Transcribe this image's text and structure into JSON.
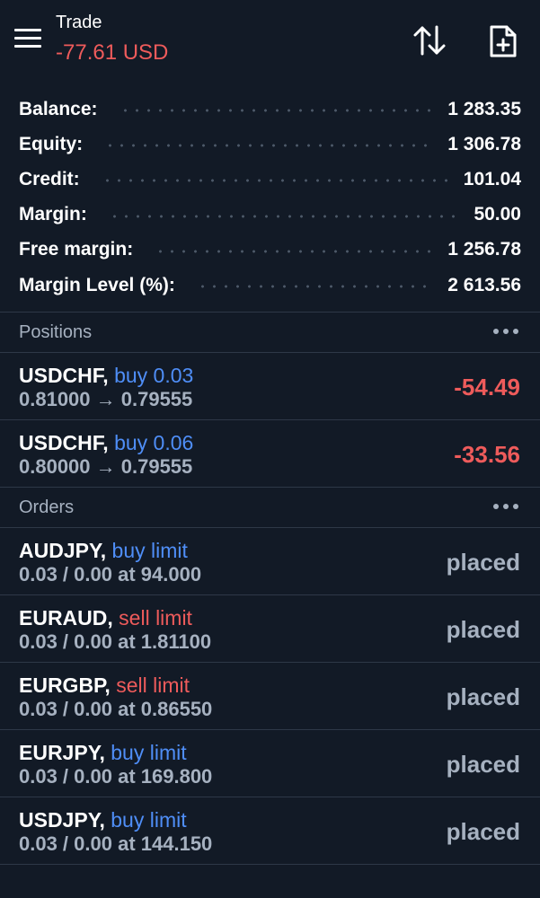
{
  "colors": {
    "background": "#121a26",
    "negative": "#ee5b5b",
    "buy": "#4f8ef7",
    "sell": "#ee5b5b",
    "muted": "#a6b1c0",
    "divider": "#2e3847"
  },
  "header": {
    "title": "Trade",
    "total": "-77.61 USD",
    "icons": [
      "menu-icon",
      "sort-icon",
      "new-order-icon"
    ]
  },
  "summary": [
    {
      "label": "Balance:",
      "value": "1 283.35"
    },
    {
      "label": "Equity:",
      "value": "1 306.78"
    },
    {
      "label": "Credit:",
      "value": "101.04"
    },
    {
      "label": "Margin:",
      "value": "50.00"
    },
    {
      "label": "Free margin:",
      "value": "1 256.78"
    },
    {
      "label": "Margin Level (%):",
      "value": "2 613.56"
    }
  ],
  "positions": {
    "title": "Positions",
    "items": [
      {
        "symbol": "USDCHF,",
        "type": "buy 0.03",
        "prices": "0.81000 → 0.79555",
        "profit": "-54.49"
      },
      {
        "symbol": "USDCHF,",
        "type": "buy 0.06",
        "prices": "0.80000 → 0.79555",
        "profit": "-33.56"
      }
    ]
  },
  "orders": {
    "title": "Orders",
    "items": [
      {
        "symbol": "AUDJPY,",
        "type": "buy limit",
        "side": "buy",
        "details": "0.03 / 0.00 at 94.000",
        "status": "placed"
      },
      {
        "symbol": "EURAUD,",
        "type": "sell limit",
        "side": "sell",
        "details": "0.03 / 0.00 at 1.81100",
        "status": "placed"
      },
      {
        "symbol": "EURGBP,",
        "type": "sell limit",
        "side": "sell",
        "details": "0.03 / 0.00 at 0.86550",
        "status": "placed"
      },
      {
        "symbol": "EURJPY,",
        "type": "buy limit",
        "side": "buy",
        "details": "0.03 / 0.00 at 169.800",
        "status": "placed"
      },
      {
        "symbol": "USDJPY,",
        "type": "buy limit",
        "side": "buy",
        "details": "0.03 / 0.00 at 144.150",
        "status": "placed"
      }
    ]
  }
}
